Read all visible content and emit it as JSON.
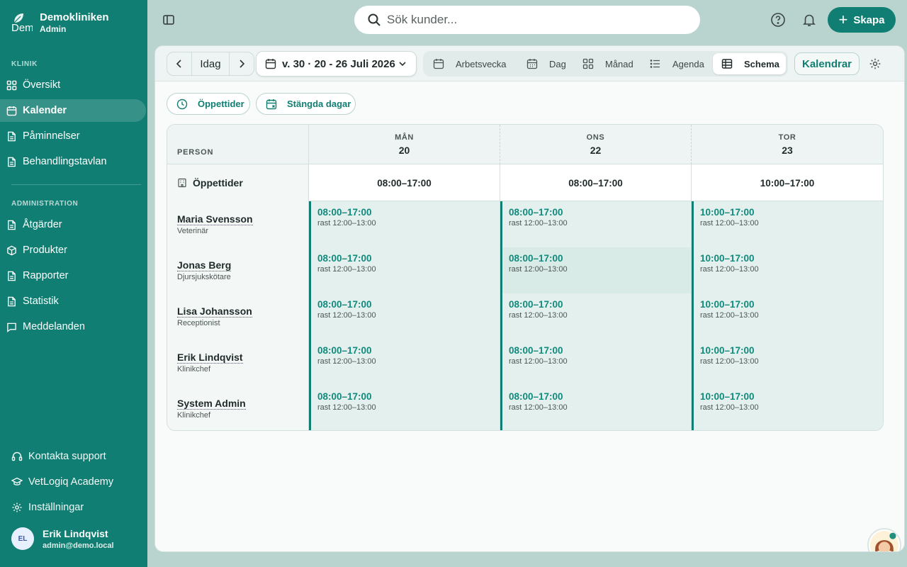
{
  "brand": {
    "name": "Demokliniken",
    "role": "Admin",
    "logo_text": "Dem"
  },
  "sidebar": {
    "section_klinik": "KLINIK",
    "klinik_items": [
      {
        "label": "Översikt",
        "icon": "grid-icon"
      },
      {
        "label": "Kalender",
        "icon": "calendar-icon",
        "active": true
      },
      {
        "label": "Påminnelser",
        "icon": "document-icon"
      },
      {
        "label": "Behandlingstavlan",
        "icon": "document-icon"
      }
    ],
    "section_admin": "ADMINISTRATION",
    "admin_items": [
      {
        "label": "Åtgärder",
        "icon": "document-icon"
      },
      {
        "label": "Produkter",
        "icon": "box-icon"
      },
      {
        "label": "Rapporter",
        "icon": "document-icon"
      },
      {
        "label": "Statistik",
        "icon": "document-icon"
      },
      {
        "label": "Meddelanden",
        "icon": "chat-icon"
      }
    ],
    "footer_items": [
      {
        "label": "Kontakta support",
        "icon": "headset-icon"
      },
      {
        "label": "VetLogiq Academy",
        "icon": "graduation-cap-icon"
      },
      {
        "label": "Inställningar",
        "icon": "gear-icon"
      }
    ],
    "user": {
      "initials": "EL",
      "name": "Erik Lindqvist",
      "email": "admin@demo.local"
    }
  },
  "topbar": {
    "search_placeholder": "Sök kunder...",
    "create_label": "Skapa"
  },
  "toolbar": {
    "today_label": "Idag",
    "week_label": "v. 30 · 20 - 26 Juli 2026",
    "views": [
      {
        "label": "Arbetsvecka",
        "icon": "calendar-icon"
      },
      {
        "label": "Dag",
        "icon": "calendar-day-icon"
      },
      {
        "label": "Månad",
        "icon": "grid-icon"
      },
      {
        "label": "Agenda",
        "icon": "list-icon"
      },
      {
        "label": "Schema",
        "icon": "table-icon",
        "active": true
      }
    ],
    "calendars_label": "Kalendrar"
  },
  "filters": {
    "opening_hours": "Öppettider",
    "closed_days": "Stängda dagar"
  },
  "schedule": {
    "person_header": "PERSON",
    "days": [
      {
        "name": "MÅN",
        "date": "20"
      },
      {
        "name": "ONS",
        "date": "22"
      },
      {
        "name": "TOR",
        "date": "23"
      }
    ],
    "opening_label": "Öppettider",
    "opening_hours": [
      "08:00–17:00",
      "08:00–17:00",
      "10:00–17:00"
    ],
    "staff": [
      {
        "name": "Maria Svensson",
        "role": "Veterinär",
        "shifts": [
          {
            "time": "08:00–17:00",
            "break": "rast 12:00–13:00"
          },
          {
            "time": "08:00–17:00",
            "break": "rast 12:00–13:00"
          },
          {
            "time": "10:00–17:00",
            "break": "rast 12:00–13:00"
          }
        ]
      },
      {
        "name": "Jonas Berg",
        "role": "Djursjukskötare",
        "shifts": [
          {
            "time": "08:00–17:00",
            "break": "rast 12:00–13:00"
          },
          {
            "time": "08:00–17:00",
            "break": "rast 12:00–13:00"
          },
          {
            "time": "10:00–17:00",
            "break": "rast 12:00–13:00"
          }
        ]
      },
      {
        "name": "Lisa Johansson",
        "role": "Receptionist",
        "shifts": [
          {
            "time": "08:00–17:00",
            "break": "rast 12:00–13:00"
          },
          {
            "time": "08:00–17:00",
            "break": "rast 12:00–13:00"
          },
          {
            "time": "10:00–17:00",
            "break": "rast 12:00–13:00"
          }
        ]
      },
      {
        "name": "Erik Lindqvist",
        "role": "Klinikchef",
        "shifts": [
          {
            "time": "08:00–17:00",
            "break": "rast 12:00–13:00"
          },
          {
            "time": "08:00–17:00",
            "break": "rast 12:00–13:00"
          },
          {
            "time": "10:00–17:00",
            "break": "rast 12:00–13:00"
          }
        ]
      },
      {
        "name": "System Admin",
        "role": "Klinikchef",
        "shifts": [
          {
            "time": "08:00–17:00",
            "break": "rast 12:00–13:00"
          },
          {
            "time": "08:00–17:00",
            "break": "rast 12:00–13:00"
          },
          {
            "time": "10:00–17:00",
            "break": "rast 12:00–13:00"
          }
        ]
      }
    ]
  },
  "colors": {
    "primary": "#107e72",
    "shift_bg": "#e4f0ee",
    "shift_text": "#0f8a7c"
  }
}
